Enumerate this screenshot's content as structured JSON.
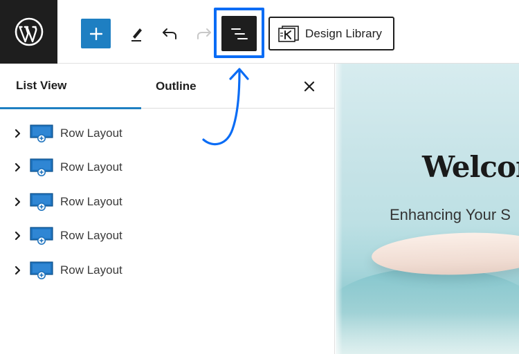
{
  "toolbar": {
    "logo_icon": "wordpress-logo-icon",
    "add_icon": "plus-icon",
    "tools_icon": "pencil-icon",
    "undo_icon": "undo-icon",
    "redo_icon": "redo-icon",
    "list_view_icon": "list-view-icon",
    "design_library_label": "Design Library",
    "design_library_icon": "design-library-icon"
  },
  "panel": {
    "tabs": [
      {
        "label": "List View",
        "active": true
      },
      {
        "label": "Outline",
        "active": false
      }
    ],
    "close_icon": "close-icon",
    "items": [
      {
        "label": "Row Layout",
        "icon": "row-layout-icon"
      },
      {
        "label": "Row Layout",
        "icon": "row-layout-icon"
      },
      {
        "label": "Row Layout",
        "icon": "row-layout-icon"
      },
      {
        "label": "Row Layout",
        "icon": "row-layout-icon"
      },
      {
        "label": "Row Layout",
        "icon": "row-layout-icon"
      }
    ]
  },
  "preview": {
    "heading": "Welcom",
    "subheading": "Enhancing Your S"
  },
  "colors": {
    "accent": "#1e7fc2",
    "highlight": "#0a6cf5",
    "dark": "#1e1e1e"
  }
}
